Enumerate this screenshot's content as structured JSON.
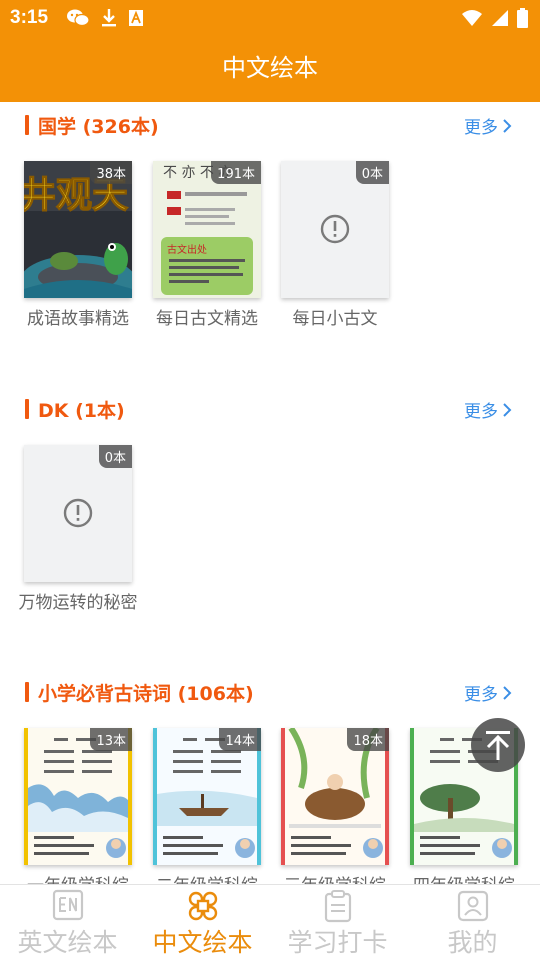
{
  "status_bar": {
    "time": "3:15",
    "left_icons": [
      "wechat-icon",
      "download-icon",
      "text-a-icon"
    ],
    "right_icons": [
      "wifi-icon",
      "signal-icon",
      "battery-icon"
    ]
  },
  "app_bar": {
    "title": "中文绘本"
  },
  "sections": [
    {
      "title": "国学 (326本)",
      "more": "更多",
      "books": [
        {
          "name": "成语故事精选",
          "count": "38本",
          "cover": "image"
        },
        {
          "name": "每日古文精选",
          "count": "191本",
          "cover": "image"
        },
        {
          "name": "每日小古文",
          "count": "0本",
          "cover": "placeholder"
        }
      ]
    },
    {
      "title": "DK (1本)",
      "more": "更多",
      "books": [
        {
          "name": "万物运转的秘密",
          "count": "0本",
          "cover": "placeholder"
        }
      ]
    },
    {
      "title": "小学必背古诗词 (106本)",
      "more": "更多",
      "books": [
        {
          "name": "一年级学科综",
          "count": "13本",
          "cover": "image"
        },
        {
          "name": "二年级学科综",
          "count": "14本",
          "cover": "image"
        },
        {
          "name": "三年级学科综",
          "count": "18本",
          "cover": "image"
        },
        {
          "name": "四年级学科综",
          "count": "",
          "cover": "image"
        }
      ]
    }
  ],
  "cover_texts": {
    "s0b0": "井观天",
    "s0b1_top": "不 亦 不 亦",
    "s0b1_h1": "古文出处"
  },
  "bottom_nav": [
    {
      "label": "英文绘本",
      "icon": "en-book-icon",
      "active": false
    },
    {
      "label": "中文绘本",
      "icon": "clover-icon",
      "active": true
    },
    {
      "label": "学习打卡",
      "icon": "clipboard-icon",
      "active": false
    },
    {
      "label": "我的",
      "icon": "profile-card-icon",
      "active": false
    }
  ],
  "colors": {
    "primary": "#F39106",
    "section_title": "#F0590F",
    "more_link": "#3A8EE6",
    "tab_active": "#EA8C0C",
    "tab_inactive": "#C8C8C8"
  }
}
